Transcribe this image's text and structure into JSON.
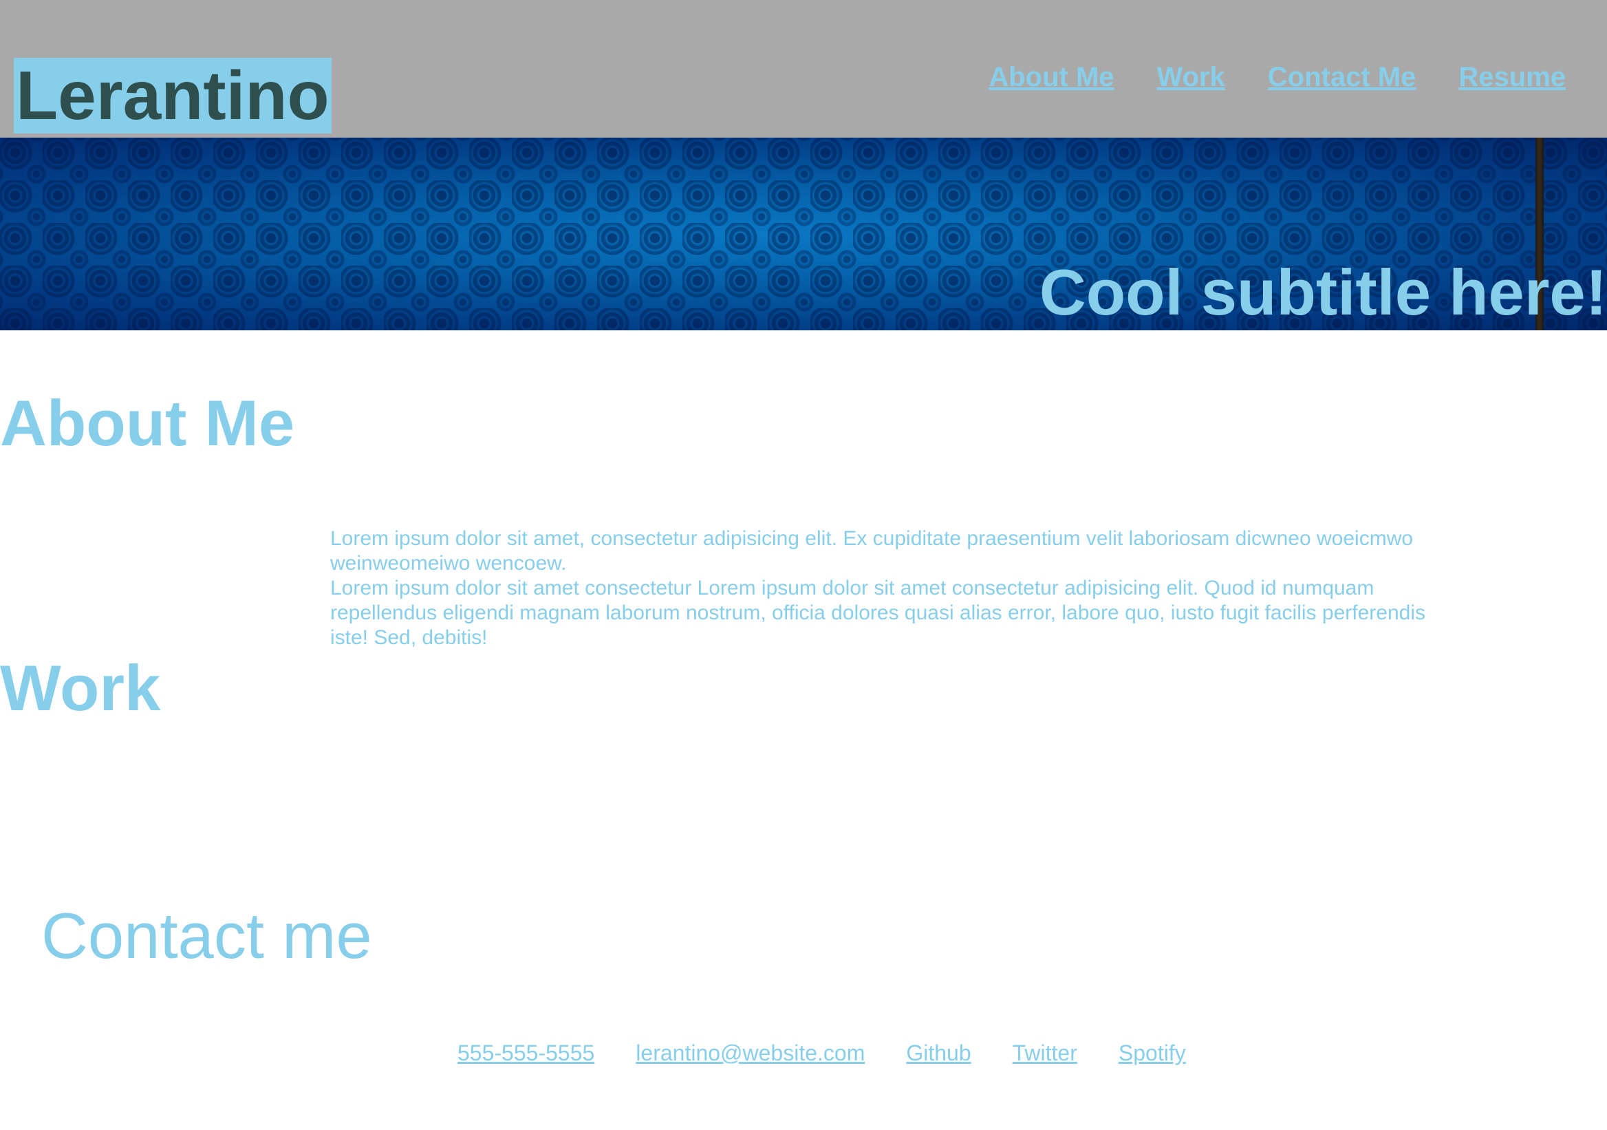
{
  "header": {
    "logo": "Lerantino",
    "nav": [
      {
        "label": "About Me"
      },
      {
        "label": "Work"
      },
      {
        "label": "Contact Me"
      },
      {
        "label": "Resume"
      }
    ]
  },
  "banner": {
    "subtitle": "Cool subtitle here!"
  },
  "about": {
    "heading": "About Me",
    "paragraph1": "Lorem ipsum dolor sit amet, consectetur adipisicing elit. Ex cupiditate praesentium velit laboriosam dicwneo woeicmwo weinweomeiwo wencoew.",
    "paragraph2": "Lorem ipsum dolor sit amet consectetur Lorem ipsum dolor sit amet consectetur adipisicing elit. Quod id numquam repellendus eligendi magnam laborum nostrum, officia dolores quasi alias error, labore quo, iusto fugit facilis perferendis iste! Sed, debitis!"
  },
  "work": {
    "heading": "Work"
  },
  "contact": {
    "heading": "Contact me",
    "links": [
      {
        "label": "555-555-5555"
      },
      {
        "label": "lerantino@website.com"
      },
      {
        "label": "Github"
      },
      {
        "label": "Twitter"
      },
      {
        "label": "Spotify"
      }
    ]
  },
  "colors": {
    "accent": "#87ceeb",
    "header_bg": "#a9a9a9",
    "logo_text": "#2f4f4f"
  }
}
